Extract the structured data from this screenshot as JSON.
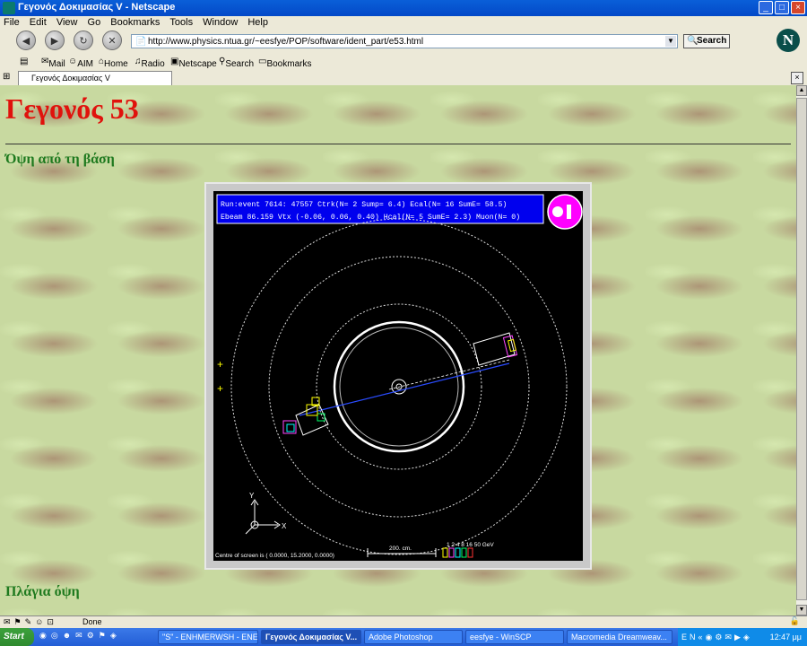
{
  "window": {
    "title": "Γεγονός Δοκιμασίας V - Netscape"
  },
  "menu": [
    "File",
    "Edit",
    "View",
    "Go",
    "Bookmarks",
    "Tools",
    "Window",
    "Help"
  ],
  "nav": {
    "url": "http://www.physics.ntua.gr/~eesfye/POP/software/ident_part/e53.html",
    "search_label": "Search"
  },
  "bookmarks": [
    "Mail",
    "AIM",
    "Home",
    "Radio",
    "Netscape",
    "Search",
    "Bookmarks"
  ],
  "tab": {
    "label": "Γεγονός Δοκιμασίας V"
  },
  "page": {
    "title": "Γεγονός 53",
    "subtitle_top": "Όψη από τη βάση",
    "subtitle_side": "Πλάγια όψη"
  },
  "event_display": {
    "header_line1": "Run:event 7614: 47557    Ctrk(N=  2 Sump=  6.4) Ecal(N= 16 SumE= 58.5)",
    "header_line2": "Ebeam 86.159 Vtx (-0.06, 0.06, 0.40) Hcal(N= 5 SumE=  2.3) Muon(N= 0)",
    "footer_centre": "Centre of screen is (   0.0000,  15.2000,   0.0000)",
    "scale_label": "200. cm.",
    "energy_scale": "1 2 4 8 16 50 GeV",
    "axis_x": "X",
    "axis_y": "Y"
  },
  "status": {
    "text": "Done"
  },
  "taskbar": {
    "start": "Start",
    "tasks": [
      "\"S\" - ENHMERWSH - ENE...",
      "Γεγονός Δοκιμασίας V...",
      "Adobe Photoshop",
      "eesfye - WinSCP",
      "Macromedia Dreamweav..."
    ],
    "clock": "12:47 μμ"
  },
  "colors": {
    "title_red": "#e0120c",
    "subtitle_green": "#1f7a1f",
    "display_bg": "#000000",
    "header_blue": "#0000ff"
  }
}
